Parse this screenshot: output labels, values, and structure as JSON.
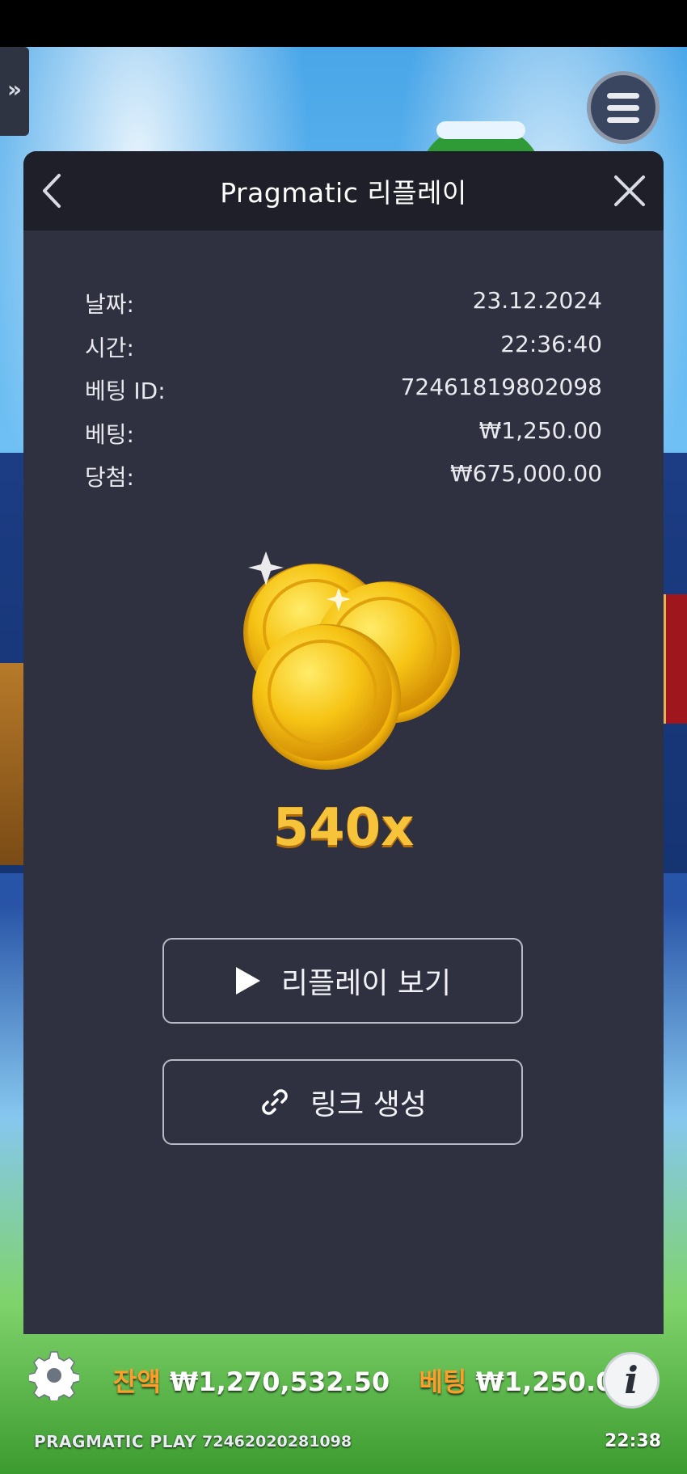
{
  "game": {
    "menu_icon": "hamburger-icon",
    "expand_icon": "double-chevron-right-icon"
  },
  "modal": {
    "title": "Pragmatic 리플레이",
    "back_icon": "chevron-left-icon",
    "close_icon": "close-icon",
    "details": [
      {
        "label": "날짜:",
        "value": "23.12.2024"
      },
      {
        "label": "시간:",
        "value": "22:36:40"
      },
      {
        "label": "베팅 ID:",
        "value": "72461819802098"
      },
      {
        "label": "베팅:",
        "value": "₩1,250.00"
      },
      {
        "label": "당첨:",
        "value": "₩675,000.00"
      }
    ],
    "multiplier": "540x",
    "replay_button": {
      "label": "리플레이 보기",
      "icon": "play-icon"
    },
    "link_button": {
      "label": "링크 생성",
      "icon": "link-icon"
    }
  },
  "bottom_bar": {
    "settings_icon": "gear-icon",
    "balance_label": "잔액",
    "balance_value": "₩1,270,532.50",
    "bet_label": "베팅",
    "bet_value": "₩1,250.00",
    "info_label": "i",
    "brand": "PRAGMATIC PLAY",
    "session_id": "72462020281098",
    "clock": "22:38"
  },
  "colors": {
    "modal_bg": "#2f3040",
    "modal_header_bg": "#1e1f29",
    "accent_orange": "#ff9d2a",
    "multiplier_gold": "#f7c33b"
  }
}
